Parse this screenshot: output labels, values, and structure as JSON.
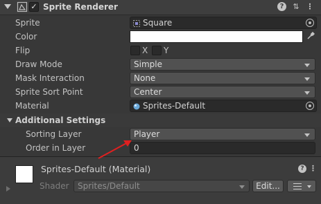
{
  "component": {
    "title": "Sprite Renderer",
    "enabled_mark": "✓",
    "help_glyph": "?",
    "settings_glyph": "⇅",
    "menu_glyph": "⋮"
  },
  "properties": {
    "sprite": {
      "label": "Sprite",
      "value": "Square"
    },
    "color": {
      "label": "Color",
      "value": "#ffffff"
    },
    "flip": {
      "label": "Flip",
      "x_label": "X",
      "y_label": "Y"
    },
    "draw_mode": {
      "label": "Draw Mode",
      "value": "Simple"
    },
    "mask_interaction": {
      "label": "Mask Interaction",
      "value": "None"
    },
    "sprite_sort_point": {
      "label": "Sprite Sort Point",
      "value": "Center"
    },
    "material": {
      "label": "Material",
      "value": "Sprites-Default"
    }
  },
  "additional_settings": {
    "title": "Additional Settings",
    "sorting_layer": {
      "label": "Sorting Layer",
      "value": "Player"
    },
    "order_in_layer": {
      "label": "Order in Layer",
      "value": "0"
    }
  },
  "material_section": {
    "title": "Sprites-Default (Material)",
    "shader_label": "Shader",
    "shader_value": "Sprites/Default",
    "edit_label": "Edit...",
    "help_glyph": "?",
    "menu_glyph": "⋮"
  },
  "colors": {
    "panel_bg": "#383838",
    "annotation_arrow": "#e02020"
  },
  "icons": {
    "component": "sprite-renderer-icon",
    "eyedropper": "eyedropper-icon",
    "object_picker": "object-picker-icon"
  }
}
